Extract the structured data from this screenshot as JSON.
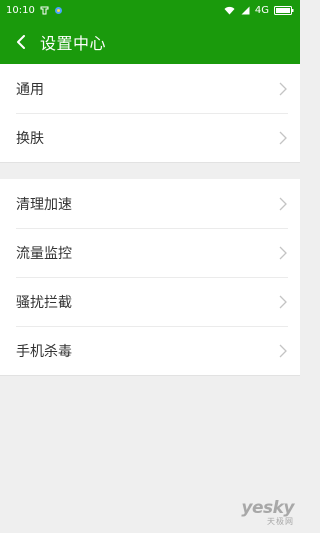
{
  "status_bar": {
    "time": "10:10",
    "network": "4G"
  },
  "header": {
    "title": "设置中心"
  },
  "groups": [
    {
      "items": [
        {
          "label": "通用"
        },
        {
          "label": "换肤"
        }
      ]
    },
    {
      "items": [
        {
          "label": "清理加速"
        },
        {
          "label": "流量监控"
        },
        {
          "label": "骚扰拦截"
        },
        {
          "label": "手机杀毒"
        }
      ]
    }
  ],
  "watermark": {
    "brand": "yesky",
    "sub": "天极网"
  },
  "colors": {
    "accent": "#1a9a0c",
    "background": "#efefef",
    "divider": "#ebebeb"
  }
}
